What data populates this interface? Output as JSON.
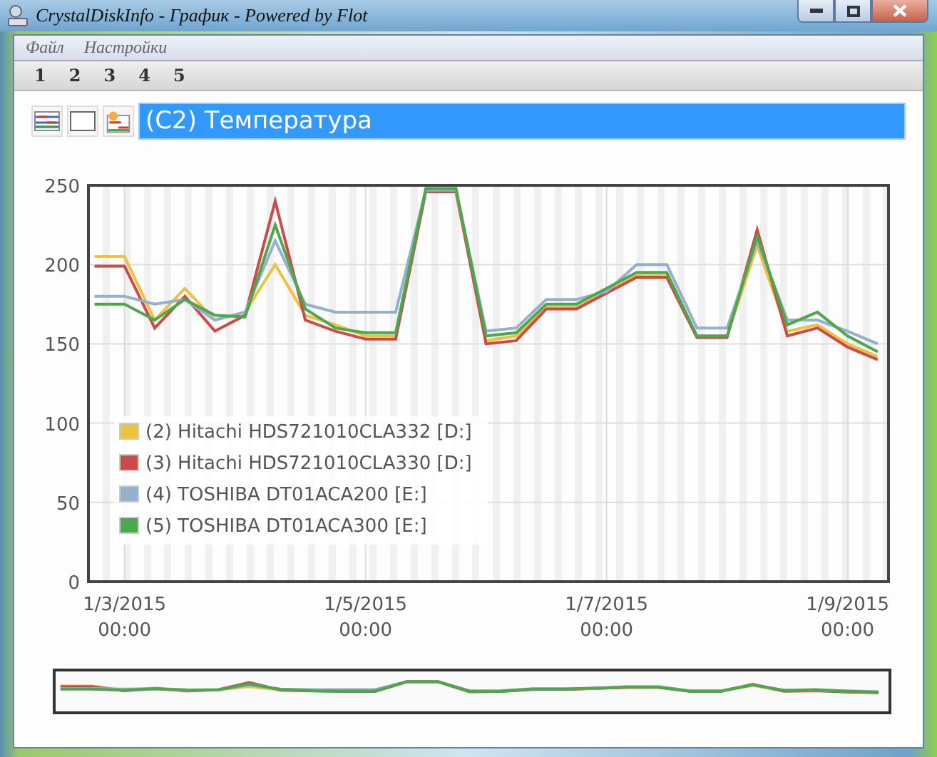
{
  "window": {
    "title": "CrystalDiskInfo - График - Powered by Flot"
  },
  "menu": [
    "Файл",
    "Настройки"
  ],
  "tabs": [
    {
      "label": "1",
      "selected": false
    },
    {
      "label": "2",
      "selected": false
    },
    {
      "label": "3",
      "selected": false
    },
    {
      "label": "4",
      "selected": false
    },
    {
      "label": "5",
      "selected": false
    }
  ],
  "attribute": {
    "value": "(C2) Температура"
  },
  "chart_data": {
    "type": "line",
    "grid": true,
    "legend": true,
    "ylim": [
      0,
      250
    ],
    "yticks": [
      0,
      50,
      100,
      150,
      200,
      250
    ],
    "categories": [
      null,
      "1/3/2015 00:00",
      null,
      null,
      null,
      null,
      null,
      null,
      null,
      "1/5/2015 00:00",
      null,
      null,
      null,
      null,
      null,
      null,
      null,
      "1/7/2015 00:00",
      null,
      null,
      null,
      null,
      null,
      null,
      null,
      "1/9/2015 00:00",
      null
    ],
    "series": [
      {
        "name": "(2) Hitachi HDS721010CLA332 [D:]",
        "color": "#edc240",
        "values": [
          205,
          205,
          165,
          185,
          165,
          170,
          200,
          168,
          162,
          155,
          155,
          247,
          247,
          152,
          155,
          173,
          173,
          183,
          193,
          193,
          155,
          155,
          212,
          158,
          162,
          150,
          142
        ]
      },
      {
        "name": "(3) Hitachi HDS721010CLA330 [D:]",
        "color": "#cb4b4b",
        "values": [
          199,
          199,
          160,
          180,
          158,
          168,
          240,
          165,
          158,
          153,
          153,
          246,
          246,
          150,
          152,
          172,
          172,
          182,
          192,
          192,
          154,
          154,
          222,
          155,
          160,
          148,
          140
        ]
      },
      {
        "name": "(4) TOSHIBA DT01ACA200 [E:]",
        "color": "#94b0cc",
        "values": [
          180,
          180,
          175,
          178,
          165,
          170,
          215,
          175,
          170,
          170,
          170,
          247,
          247,
          158,
          160,
          178,
          178,
          183,
          200,
          200,
          160,
          160,
          215,
          165,
          165,
          158,
          150
        ]
      },
      {
        "name": "(5) TOSHIBA DT01ACA300 [E:]",
        "color": "#4da74d",
        "values": [
          175,
          175,
          165,
          178,
          168,
          167,
          225,
          172,
          160,
          157,
          157,
          248,
          248,
          155,
          157,
          175,
          175,
          185,
          195,
          195,
          155,
          155,
          218,
          162,
          170,
          155,
          145
        ]
      }
    ]
  }
}
